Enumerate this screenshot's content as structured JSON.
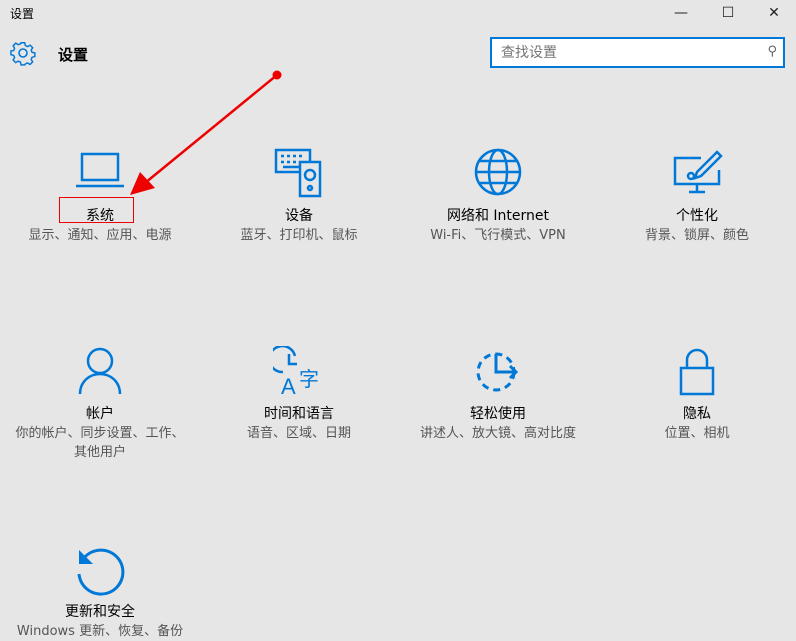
{
  "window": {
    "title": "设置",
    "minimize": "—",
    "maximize": "☐",
    "close": "✕"
  },
  "header": {
    "title": "设置",
    "icon": "gear-icon"
  },
  "search": {
    "placeholder": "查找设置",
    "icon": "search-icon"
  },
  "tiles": [
    {
      "name": "系统",
      "desc": "显示、通知、应用、电源",
      "icon": "laptop-icon"
    },
    {
      "name": "设备",
      "desc": "蓝牙、打印机、鼠标",
      "icon": "devices-icon"
    },
    {
      "name": "网络和 Internet",
      "desc": "Wi-Fi、飞行模式、VPN",
      "icon": "globe-icon"
    },
    {
      "name": "个性化",
      "desc": "背景、锁屏、颜色",
      "icon": "personalization-icon"
    },
    {
      "name": "帐户",
      "desc": "你的帐户、同步设置、工作、其他用户",
      "icon": "person-icon"
    },
    {
      "name": "时间和语言",
      "desc": "语音、区域、日期",
      "icon": "time-language-icon"
    },
    {
      "name": "轻松使用",
      "desc": "讲述人、放大镜、高对比度",
      "icon": "ease-of-access-icon"
    },
    {
      "name": "隐私",
      "desc": "位置、相机",
      "icon": "lock-icon"
    },
    {
      "name": "更新和安全",
      "desc": "Windows 更新、恢复、备份",
      "icon": "refresh-icon"
    }
  ],
  "colors": {
    "accent": "#0078d7",
    "annotation": "#e00000"
  }
}
